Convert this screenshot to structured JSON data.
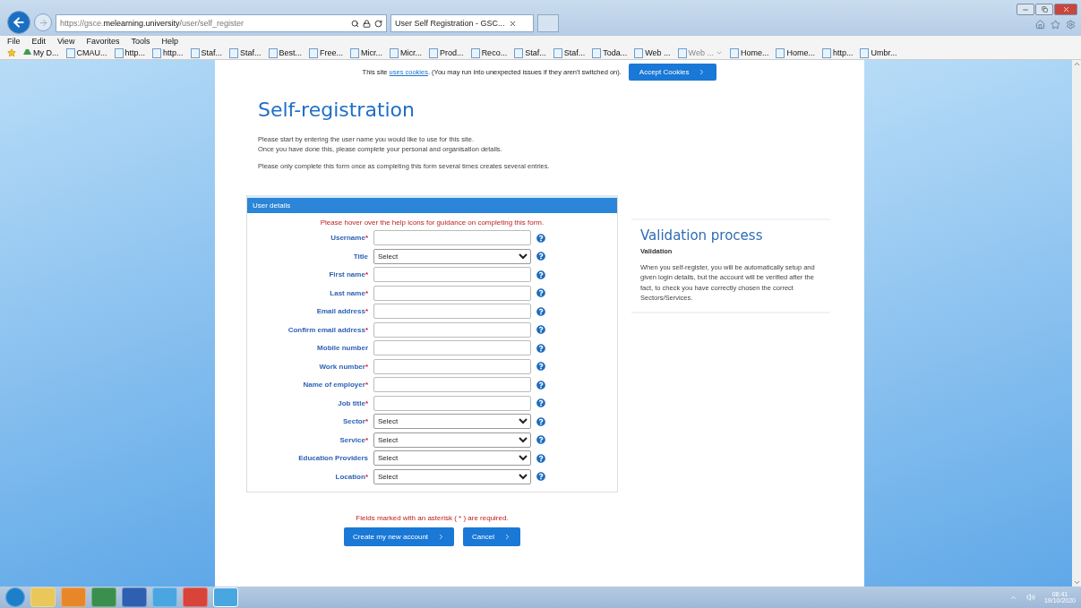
{
  "browser": {
    "address": {
      "scheme": "https://",
      "host_before": "gsce.",
      "host_domain": "melearning.university",
      "path": "/user/self_register"
    },
    "tab_title": "User Self Registration - GSC...",
    "menu": [
      "File",
      "Edit",
      "View",
      "Favorites",
      "Tools",
      "Help"
    ],
    "favorites": [
      {
        "label": "My D...",
        "kind": "drive",
        "dropdown": false
      },
      {
        "label": "CMAU...",
        "kind": "page",
        "dropdown": false
      },
      {
        "label": "http...",
        "kind": "page",
        "dropdown": false
      },
      {
        "label": "http...",
        "kind": "page",
        "dropdown": false
      },
      {
        "label": "Staf...",
        "kind": "page",
        "dropdown": false
      },
      {
        "label": "Staf...",
        "kind": "page",
        "dropdown": false
      },
      {
        "label": "Best...",
        "kind": "page",
        "dropdown": false
      },
      {
        "label": "Free...",
        "kind": "page",
        "dropdown": false
      },
      {
        "label": "Micr...",
        "kind": "page",
        "dropdown": false
      },
      {
        "label": "Micr...",
        "kind": "page",
        "dropdown": false
      },
      {
        "label": "Prod...",
        "kind": "page",
        "dropdown": false
      },
      {
        "label": "Reco...",
        "kind": "page",
        "dropdown": false
      },
      {
        "label": "Staf...",
        "kind": "page",
        "dropdown": false
      },
      {
        "label": "Staf...",
        "kind": "page",
        "dropdown": false
      },
      {
        "label": "Toda...",
        "kind": "page",
        "dropdown": false
      },
      {
        "label": "Web ...",
        "kind": "page",
        "dropdown": false
      },
      {
        "label": "Web ...",
        "kind": "page",
        "dropdown": true
      },
      {
        "label": "Home...",
        "kind": "page",
        "dropdown": false
      },
      {
        "label": "Home...",
        "kind": "page",
        "dropdown": false
      },
      {
        "label": "http...",
        "kind": "page",
        "dropdown": false
      },
      {
        "label": "Umbr...",
        "kind": "page",
        "dropdown": false
      }
    ]
  },
  "cookie_bar": {
    "before": "This site ",
    "link": "uses cookies",
    "after": ". (You may run into unexpected issues if they aren't switched on).",
    "button": "Accept Cookies"
  },
  "page": {
    "title": "Self-registration",
    "intro": [
      "Please start by entering the user name you would like to use for this site.",
      "Once you have done this, please complete your personal and organisation details."
    ],
    "warning": "Please only complete this form once as completing this form several times creates several entries.",
    "form": {
      "header": "User details",
      "hint": "Please hover over the help icons for guidance on completing this form.",
      "fields": [
        {
          "label": "Username",
          "mark": "*",
          "kind": "text"
        },
        {
          "label": "Title",
          "kind": "select",
          "value": "Select"
        },
        {
          "label": "First name",
          "mark": "*",
          "kind": "text"
        },
        {
          "label": "Last name",
          "mark": "*",
          "kind": "text"
        },
        {
          "label": "Email address",
          "mark": "*",
          "kind": "text"
        },
        {
          "label": "Confirm email address",
          "mark": "*",
          "kind": "text"
        },
        {
          "label": "Mobile number",
          "kind": "text"
        },
        {
          "label": "Work number",
          "mark": "*",
          "kind": "text"
        },
        {
          "label": "Name of employer",
          "mark": "*",
          "kind": "text"
        },
        {
          "label": "Job title",
          "mark": "*",
          "kind": "text"
        },
        {
          "label": "Sector",
          "mark": "*",
          "kind": "select",
          "value": "Select"
        },
        {
          "label": "Service",
          "mark": "*",
          "kind": "select",
          "value": "Select"
        },
        {
          "label": "Education Providers",
          "kind": "select",
          "value": "Select"
        },
        {
          "label": "Location",
          "mark": "*",
          "kind": "select",
          "value": "Select"
        }
      ]
    },
    "required_note": {
      "before": "Fields marked with an asterisk ( ",
      "mark": "*",
      "after": " ) are required."
    },
    "buttons": [
      "Create my new account",
      "Cancel"
    ],
    "side": {
      "title": "Validation process",
      "subtitle": "Validation",
      "text": "When you self-register, you will be automatically setup and given login details, but the account will be verified after the fact, to check you have correctly chosen the correct Sectors/Services."
    }
  },
  "taskbar": {
    "apps": [
      {
        "kind": "start"
      },
      {
        "kind": "folder"
      },
      {
        "kind": "outlook"
      },
      {
        "kind": "excel"
      },
      {
        "kind": "word"
      },
      {
        "kind": "ie"
      },
      {
        "kind": "chrome"
      },
      {
        "kind": "ie",
        "selected": true
      }
    ],
    "time": "08:41",
    "date": "19/10/2020"
  }
}
